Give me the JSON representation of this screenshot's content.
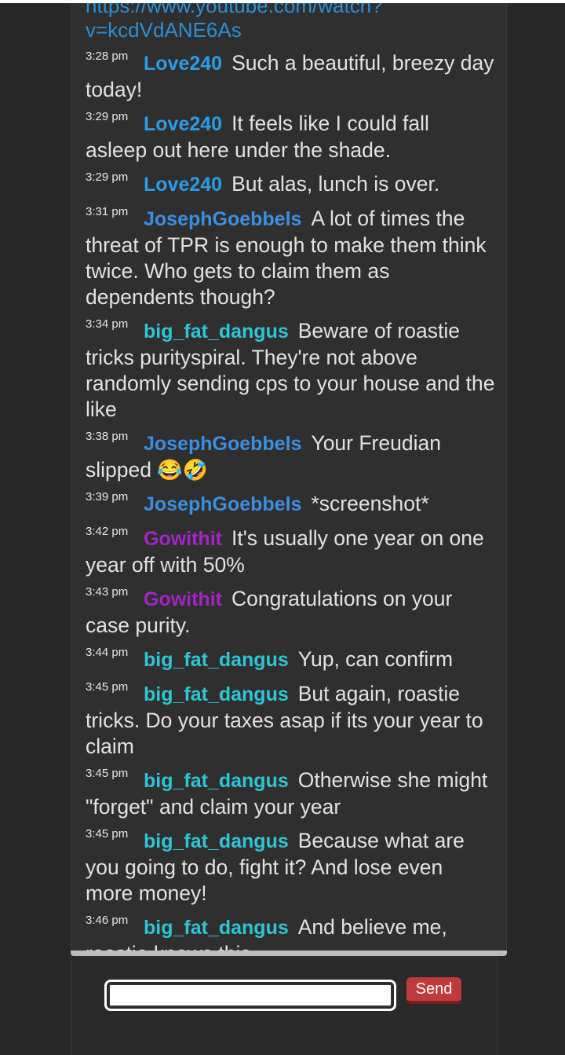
{
  "chat": {
    "link_line_1": "https://www.youtube.com/watch?",
    "link_line_2": "v=kcdVdANE6As",
    "messages": [
      {
        "time": "3:28 pm",
        "user": "Love240",
        "text": "Such a beautiful, breezy day today!",
        "user_color": "#2b9ce6"
      },
      {
        "time": "3:29 pm",
        "user": "Love240",
        "text": "It feels like I could fall asleep out here under the shade.",
        "user_color": "#2b9ce6"
      },
      {
        "time": "3:29 pm",
        "user": "Love240",
        "text": "But alas, lunch is over.",
        "user_color": "#2b9ce6"
      },
      {
        "time": "3:31 pm",
        "user": "JosephGoebbels",
        "text": "A lot of times the threat of TPR is enough to make them think twice. Who gets to claim them as dependents though?",
        "user_color": "#3b8fe0"
      },
      {
        "time": "3:34 pm",
        "user": "big_fat_dangus",
        "text": "Beware of roastie tricks purityspiral. They're not above randomly sending cps to your house and the like",
        "user_color": "#2ec6d6"
      },
      {
        "time": "3:38 pm",
        "user": "JosephGoebbels",
        "text": "Your Freudian slipped",
        "emoji": "😂🤣",
        "user_color": "#3b8fe0"
      },
      {
        "time": "3:39 pm",
        "user": "JosephGoebbels",
        "text": "*screenshot*",
        "user_color": "#3b8fe0"
      },
      {
        "time": "3:42 pm",
        "user": "Gowithit",
        "text": "It's usually one year on one year off with 50%",
        "user_color": "#a325c8"
      },
      {
        "time": "3:43 pm",
        "user": "Gowithit",
        "text": "Congratulations on your case purity.",
        "user_color": "#a325c8"
      },
      {
        "time": "3:44 pm",
        "user": "big_fat_dangus",
        "text": "Yup, can confirm",
        "user_color": "#2ec6d6"
      },
      {
        "time": "3:45 pm",
        "user": "big_fat_dangus",
        "text": "But again, roastie tricks. Do your taxes asap if its your year to claim",
        "user_color": "#2ec6d6"
      },
      {
        "time": "3:45 pm",
        "user": "big_fat_dangus",
        "text": "Otherwise she might \"forget\" and claim your year",
        "user_color": "#2ec6d6"
      },
      {
        "time": "3:45 pm",
        "user": "big_fat_dangus",
        "text": "Because what are you going to do, fight it? And lose even more money!",
        "user_color": "#2ec6d6"
      },
      {
        "time": "3:46 pm",
        "user": "big_fat_dangus",
        "text": "And believe me, roastie knows this",
        "user_color": "#2ec6d6"
      }
    ]
  },
  "compose": {
    "input_value": "",
    "send_label": "Send"
  }
}
